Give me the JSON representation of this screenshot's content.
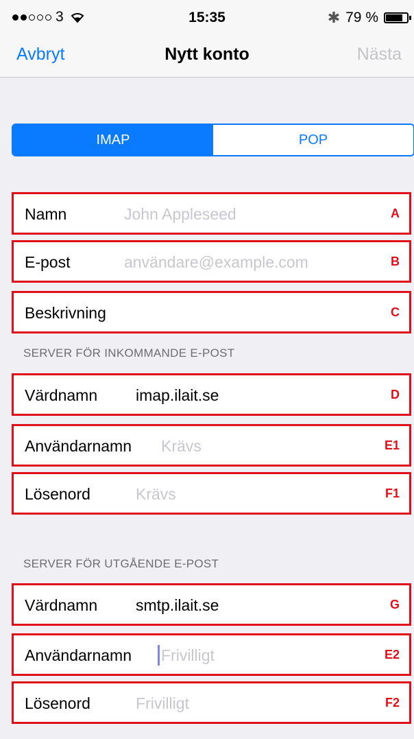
{
  "status_bar": {
    "signal_dots_filled": 2,
    "signal_dots_total": 5,
    "carrier": "3",
    "wifi_icon": "wifi-icon",
    "time": "15:35",
    "bluetooth_icon": "bluetooth-icon",
    "battery_percent": "79 %",
    "battery_level": 0.79
  },
  "nav": {
    "cancel": "Avbryt",
    "title": "Nytt konto",
    "next": "Nästa"
  },
  "segments": {
    "imap": "IMAP",
    "pop": "POP",
    "selected": "IMAP"
  },
  "account": {
    "name": {
      "label": "Namn",
      "placeholder": "John Appleseed",
      "marker": "A"
    },
    "email": {
      "label": "E-post",
      "placeholder": "användare@example.com",
      "marker": "B"
    },
    "description": {
      "label": "Beskrivning",
      "value": "",
      "marker": "C"
    }
  },
  "incoming": {
    "header": "SERVER FÖR INKOMMANDE E-POST",
    "host": {
      "label": "Värdnamn",
      "value": "imap.ilait.se",
      "marker": "D"
    },
    "username": {
      "label": "Användarnamn",
      "placeholder": "Krävs",
      "marker": "E1"
    },
    "password": {
      "label": "Lösenord",
      "placeholder": "Krävs",
      "marker": "F1"
    }
  },
  "outgoing": {
    "header": "SERVER FÖR UTGÅENDE E-POST",
    "host": {
      "label": "Värdnamn",
      "value": "smtp.ilait.se",
      "marker": "G"
    },
    "username": {
      "label": "Användarnamn",
      "placeholder": "Frivilligt",
      "marker": "E2"
    },
    "password": {
      "label": "Lösenord",
      "placeholder": "Frivilligt",
      "marker": "F2"
    }
  },
  "colors": {
    "accent": "#0a7aff",
    "marker_red": "#e0101a",
    "placeholder": "#c7c7cd",
    "background": "#efeff4"
  }
}
